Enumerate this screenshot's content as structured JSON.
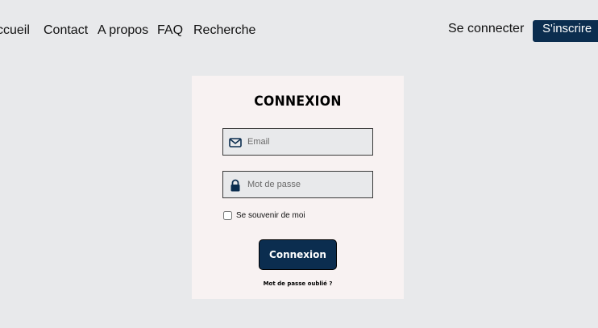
{
  "nav": {
    "links": [
      "ccueil",
      "Contact",
      "A propos",
      "FAQ",
      "Recherche"
    ]
  },
  "auth": {
    "login_label": "Se connecter",
    "signup_label": "S'inscrire"
  },
  "login_form": {
    "title": "CONNEXION",
    "email_placeholder": "Email",
    "password_placeholder": "Mot de passe",
    "remember_label": "Se souvenir de moi",
    "remember_checked": false,
    "submit_label": "Connexion",
    "forgot_label": "Mot de passe oublié ?",
    "email_icon": "envelope-icon",
    "password_icon": "lock-icon"
  },
  "colors": {
    "accent": "#0b2d4f",
    "page_background": "#e8e9eb",
    "card_background": "#f8f2f2"
  }
}
